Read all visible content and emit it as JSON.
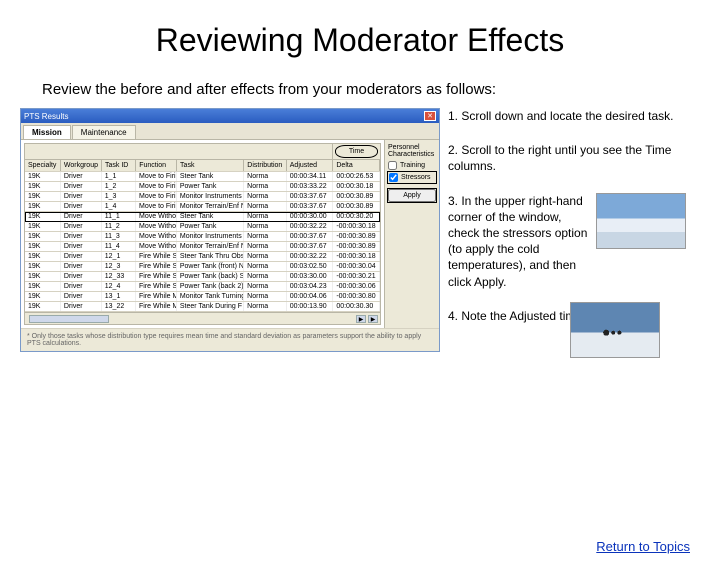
{
  "title": "Reviewing Moderator Effects",
  "subtitle": "Review the before and after effects from your moderators as follows:",
  "window": {
    "title": "PTS Results",
    "tabs": [
      "Mission",
      "Maintenance"
    ],
    "active_tab": 0,
    "time_header": "Time",
    "columns": [
      "Specialty",
      "Workgroup",
      "Task ID",
      "Function",
      "Task",
      "Distribution",
      "Adjusted",
      "Delta"
    ],
    "side_panel": {
      "heading": "Personnel Characteristics",
      "options": [
        {
          "label": "Training",
          "checked": false
        },
        {
          "label": "Stressors",
          "checked": true
        }
      ],
      "apply_label": "Apply"
    },
    "rows": [
      {
        "spec": "19K",
        "wg": "Driver",
        "tid": "1_1",
        "fn": "Move to Firing Posit",
        "task": "Steer Tank",
        "dist": "Norma",
        "adj": "00:00:34.11",
        "del": "00:00:26.53",
        "hl": false
      },
      {
        "spec": "19K",
        "wg": "Driver",
        "tid": "1_2",
        "fn": "Move to Firing Posit",
        "task": "Power Tank",
        "dist": "Norma",
        "adj": "00:03:33.22",
        "del": "00:00:30.18",
        "hl": false
      },
      {
        "spec": "19K",
        "wg": "Driver",
        "tid": "1_3",
        "fn": "Move to Firing Posit",
        "task": "Monitor Instruments",
        "dist": "Norma",
        "adj": "00:03:37.67",
        "del": "00:00:30.89",
        "hl": false
      },
      {
        "spec": "19K",
        "wg": "Driver",
        "tid": "1_4",
        "fn": "Move to Firing Posit",
        "task": "Monitor Terrain/Enf N",
        "dist": "Norma",
        "adj": "00:03:37.67",
        "del": "00:00:30.89",
        "hl": false
      },
      {
        "spec": "19K",
        "wg": "Driver",
        "tid": "11_1",
        "fn": "Move Without Firing",
        "task": "Steer Tank",
        "dist": "Norma",
        "adj": "00:00:30.00",
        "del": "00:00:30.20",
        "hl": true
      },
      {
        "spec": "19K",
        "wg": "Driver",
        "tid": "11_2",
        "fn": "Move Without Firing",
        "task": "Power Tank",
        "dist": "Norma",
        "adj": "00:00:32.22",
        "del": "-00:00:30.18",
        "hl": false
      },
      {
        "spec": "19K",
        "wg": "Driver",
        "tid": "11_3",
        "fn": "Move Without Firing",
        "task": "Monitor Instruments",
        "dist": "Norma",
        "adj": "00:00:37.67",
        "del": "-00:00:30.89",
        "hl": false
      },
      {
        "spec": "19K",
        "wg": "Driver",
        "tid": "11_4",
        "fn": "Move Without Firing",
        "task": "Monitor Terrain/Enf N",
        "dist": "Norma",
        "adj": "00:00:37.67",
        "del": "-00:00:30.89",
        "hl": false
      },
      {
        "spec": "19K",
        "wg": "Driver",
        "tid": "12_1",
        "fn": "Fire While Stationar",
        "task": "Steer Tank Thru Obs N",
        "dist": "Norma",
        "adj": "00:00:32.22",
        "del": "-00:00:30.18",
        "hl": false
      },
      {
        "spec": "19K",
        "wg": "Driver",
        "tid": "12_3",
        "fn": "Fire While Stationar",
        "task": "Power Tank (front) N",
        "dist": "Norma",
        "adj": "00:03:02.50",
        "del": "-00:00:30.04",
        "hl": false
      },
      {
        "spec": "19K",
        "wg": "Driver",
        "tid": "12_33",
        "fn": "Fire While Stationar",
        "task": "Power Tank (back) S N",
        "dist": "Norma",
        "adj": "00:03:30.00",
        "del": "-00:00:30.21",
        "hl": false
      },
      {
        "spec": "19K",
        "wg": "Driver",
        "tid": "12_4",
        "fn": "Fire While Stationar",
        "task": "Power Tank (back 2) N",
        "dist": "Norma",
        "adj": "00:03:04.23",
        "del": "-00:00:30.06",
        "hl": false
      },
      {
        "spec": "19K",
        "wg": "Driver",
        "tid": "13_1",
        "fn": "Fire While Moving",
        "task": "Monitor Tank Turning N",
        "dist": "Norma",
        "adj": "00:00:04.06",
        "del": "-00:00:30.80",
        "hl": false
      },
      {
        "spec": "19K",
        "wg": "Driver",
        "tid": "13_22",
        "fn": "Fire While Moving",
        "task": "Steer Tank During F N",
        "dist": "Norma",
        "adj": "00:00:13.90",
        "del": "00:00:30.30",
        "hl": false
      }
    ],
    "footnote": "* Only those tasks whose distribution type requires mean time and standard deviation as parameters support the ability to apply PTS calculations."
  },
  "instructions": [
    "1. Scroll down and locate the desired task.",
    "2. Scroll to the right until you see the Time columns.",
    "3.  In the upper right-hand corner of the window, check the stressors option (to apply the cold temperatures), and then click Apply.",
    "4.  Note the Adjusted time."
  ],
  "return_link": "Return to Topics"
}
